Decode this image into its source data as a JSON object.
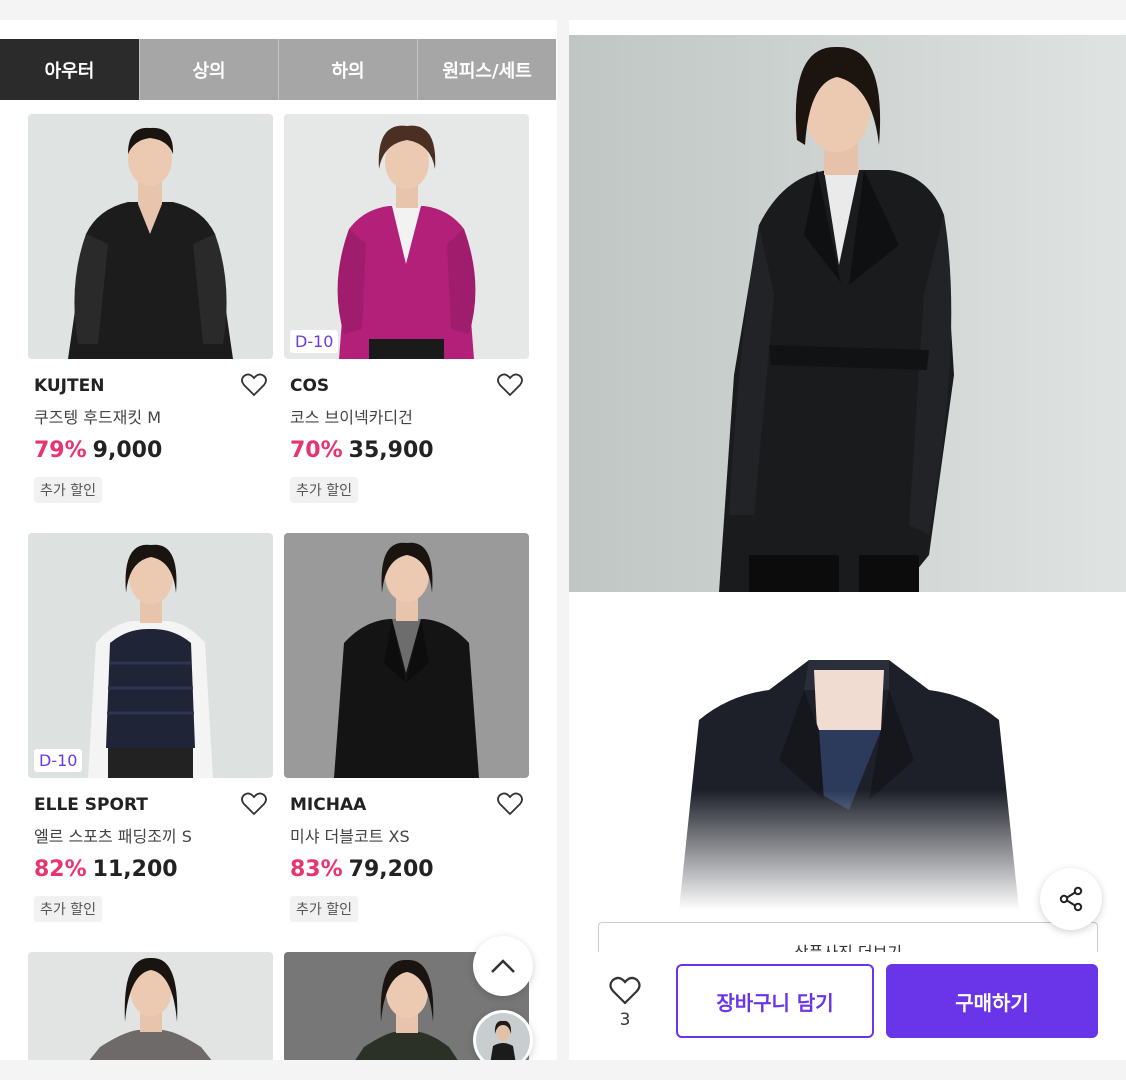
{
  "tabs": [
    {
      "label": "아우터",
      "active": true
    },
    {
      "label": "상의",
      "active": false
    },
    {
      "label": "하의",
      "active": false
    },
    {
      "label": "원피스/세트",
      "active": false
    }
  ],
  "products": [
    {
      "brand": "KUJTEN",
      "name": "쿠즈텡 후드재킷 M",
      "discount": "79%",
      "price": "9,000",
      "tag": "추가 할인",
      "badge": ""
    },
    {
      "brand": "COS",
      "name": "코스 브이넥카디건",
      "discount": "70%",
      "price": "35,900",
      "tag": "추가 할인",
      "badge": "D-10"
    },
    {
      "brand": "ELLE SPORT",
      "name": "엘르 스포츠 패딩조끼 S",
      "discount": "82%",
      "price": "11,200",
      "tag": "추가 할인",
      "badge": "D-10"
    },
    {
      "brand": "MICHAA",
      "name": "미샤 더블코트 XS",
      "discount": "83%",
      "price": "79,200",
      "tag": "추가 할인",
      "badge": ""
    }
  ],
  "detail": {
    "more_photos_label": "상품사진 더보기",
    "like_count": "3",
    "cart_label": "장바구니 담기",
    "buy_label": "구매하기"
  },
  "colors": {
    "accent": "#6a35e8",
    "discount": "#e8336e",
    "tab_active": "#2b2b2b",
    "tab_inactive": "#a6a6a6"
  },
  "icons": {
    "heart": "heart-icon",
    "share": "share-icon",
    "scroll_top": "chevron-up-icon"
  }
}
